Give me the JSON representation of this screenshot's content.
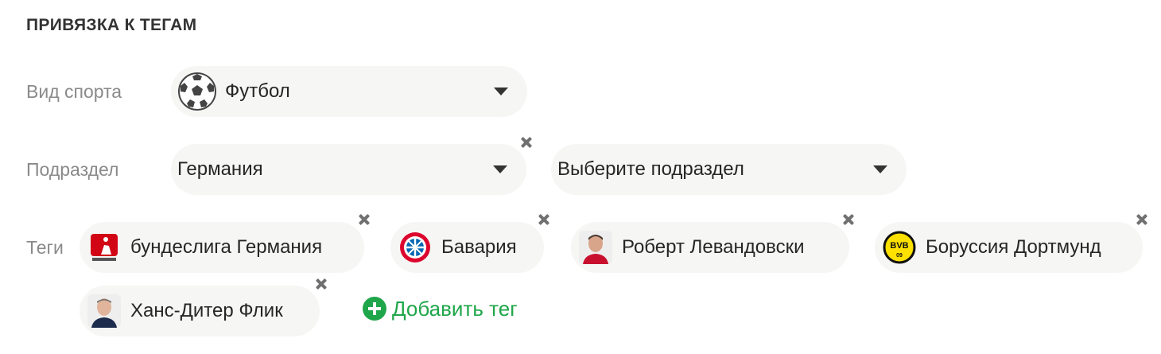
{
  "section": {
    "title": "ПРИВЯЗКА К ТЕГАМ"
  },
  "sport": {
    "label": "Вид спорта",
    "value": "Футбол",
    "icon": "soccer-ball-icon"
  },
  "subsection": {
    "label": "Подраздел",
    "value": "Германия",
    "second_placeholder": "Выберите подраздел"
  },
  "tags": {
    "label": "Теги",
    "items": [
      {
        "label": "бундеслига Германия",
        "icon": "bundesliga-logo-icon"
      },
      {
        "label": "Бавария",
        "icon": "bayern-logo-icon"
      },
      {
        "label": "Роберт Левандовски",
        "icon": "player-avatar-icon"
      },
      {
        "label": "Боруссия Дортмунд",
        "icon": "bvb-logo-icon"
      },
      {
        "label": "Ханс-Дитер Флик",
        "icon": "coach-avatar-icon"
      }
    ],
    "add_label": "Добавить тег"
  },
  "colors": {
    "pill_bg": "#f6f6f4",
    "accent_green": "#1fa64a",
    "label_gray": "#8a8a8a"
  }
}
